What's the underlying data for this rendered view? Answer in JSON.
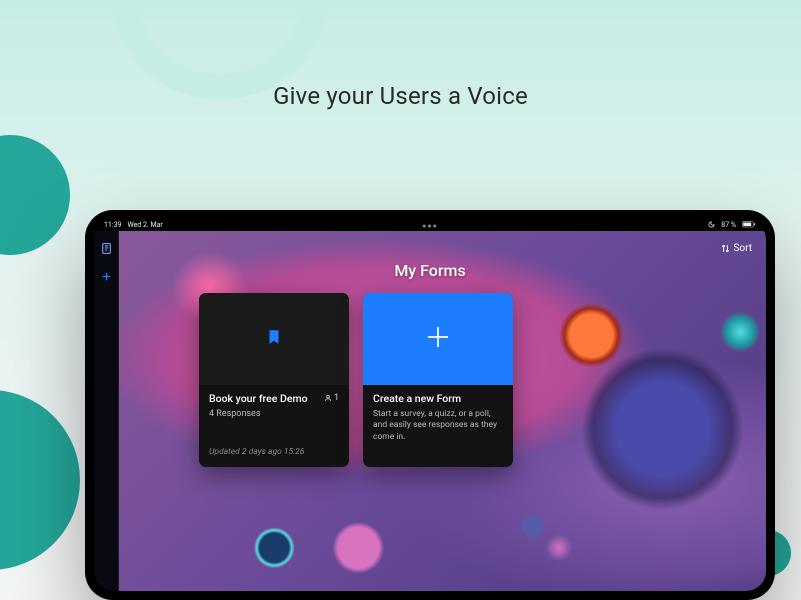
{
  "hero": {
    "title": "Give your Users a Voice"
  },
  "status_bar": {
    "time": "11:39",
    "date": "Wed 2. Mar",
    "battery": "87 %"
  },
  "toolbar": {
    "sort_label": "Sort"
  },
  "page": {
    "title": "My Forms"
  },
  "cards": {
    "demo": {
      "title": "Book your free Demo",
      "user_count": "1",
      "responses": "4 Responses",
      "updated": "Updated 2 days ago 15:26"
    },
    "new": {
      "title": "Create a new Form",
      "description": "Start a survey, a quizz, or a poll, and easily see responses as they come in."
    }
  }
}
